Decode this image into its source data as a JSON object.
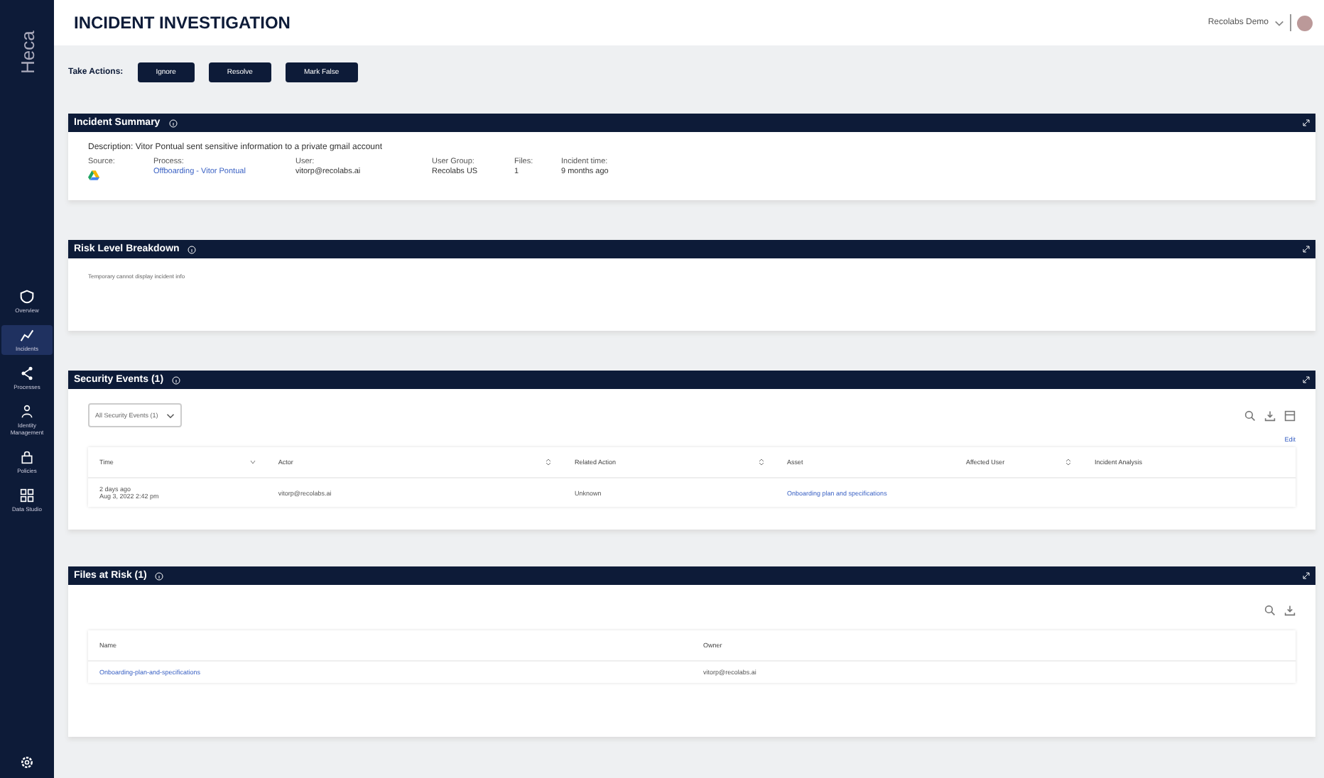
{
  "sidebar": {
    "logo": "Heca",
    "items": [
      {
        "label": "Overview",
        "selected": false
      },
      {
        "label": "Incidents",
        "selected": true
      },
      {
        "label": "Processes",
        "selected": false
      },
      {
        "label": "Identity Management",
        "selected": false
      },
      {
        "label": "Policies",
        "selected": false
      },
      {
        "label": "Data Studio",
        "selected": false
      }
    ]
  },
  "header": {
    "title": "INCIDENT INVESTIGATION",
    "account": "Recolabs Demo"
  },
  "actions": {
    "label": "Take Actions:",
    "buttons": [
      "Ignore",
      "Resolve",
      "Mark False"
    ]
  },
  "incident_summary": {
    "title": "Incident Summary",
    "description": "Description: Vitor Pontual sent sensitive information to a private gmail account",
    "fields": [
      {
        "label": "Source:",
        "kind": "icon"
      },
      {
        "label": "Process:",
        "value": "Offboarding - Vitor Pontual",
        "kind": "link"
      },
      {
        "label": "User:",
        "value": "vitorp@recolabs.ai",
        "kind": "text"
      },
      {
        "label": "User Group:",
        "value": "Recolabs US",
        "kind": "text"
      },
      {
        "label": "Files:",
        "value": "1",
        "kind": "text"
      },
      {
        "label": "Incident time:",
        "value": "9 months ago",
        "kind": "text"
      }
    ]
  },
  "risk_level_breakdown": {
    "title": "Risk Level Breakdown",
    "message": "Temporary cannot display incident info"
  },
  "security_events": {
    "title": "Security Events (1)",
    "filter": "All Security Events (1)",
    "edit_link": "Edit",
    "columns": [
      {
        "label": "Time",
        "kind": "sorted"
      },
      {
        "label": "Actor",
        "kind": "sortable"
      },
      {
        "label": "Related Action",
        "kind": "sortable"
      },
      {
        "label": "Asset",
        "kind": "plain"
      },
      {
        "label": "Affected User",
        "kind": "sortable"
      },
      {
        "label": "Incident Analysis",
        "kind": "plain"
      }
    ],
    "rows": [
      {
        "time": "2 days ago",
        "date": "Aug 3, 2022 2:42 pm",
        "actor": "vitorp@recolabs.ai",
        "related_action": "Unknown",
        "asset": "Onboarding plan and specifications"
      }
    ]
  },
  "files_at_risk": {
    "title": "Files at Risk (1)",
    "columns": [
      "Name",
      "Owner"
    ],
    "rows": [
      {
        "name": "Onboarding-plan-and-specifications",
        "owner": "vitorp@recolabs.ai"
      }
    ]
  }
}
